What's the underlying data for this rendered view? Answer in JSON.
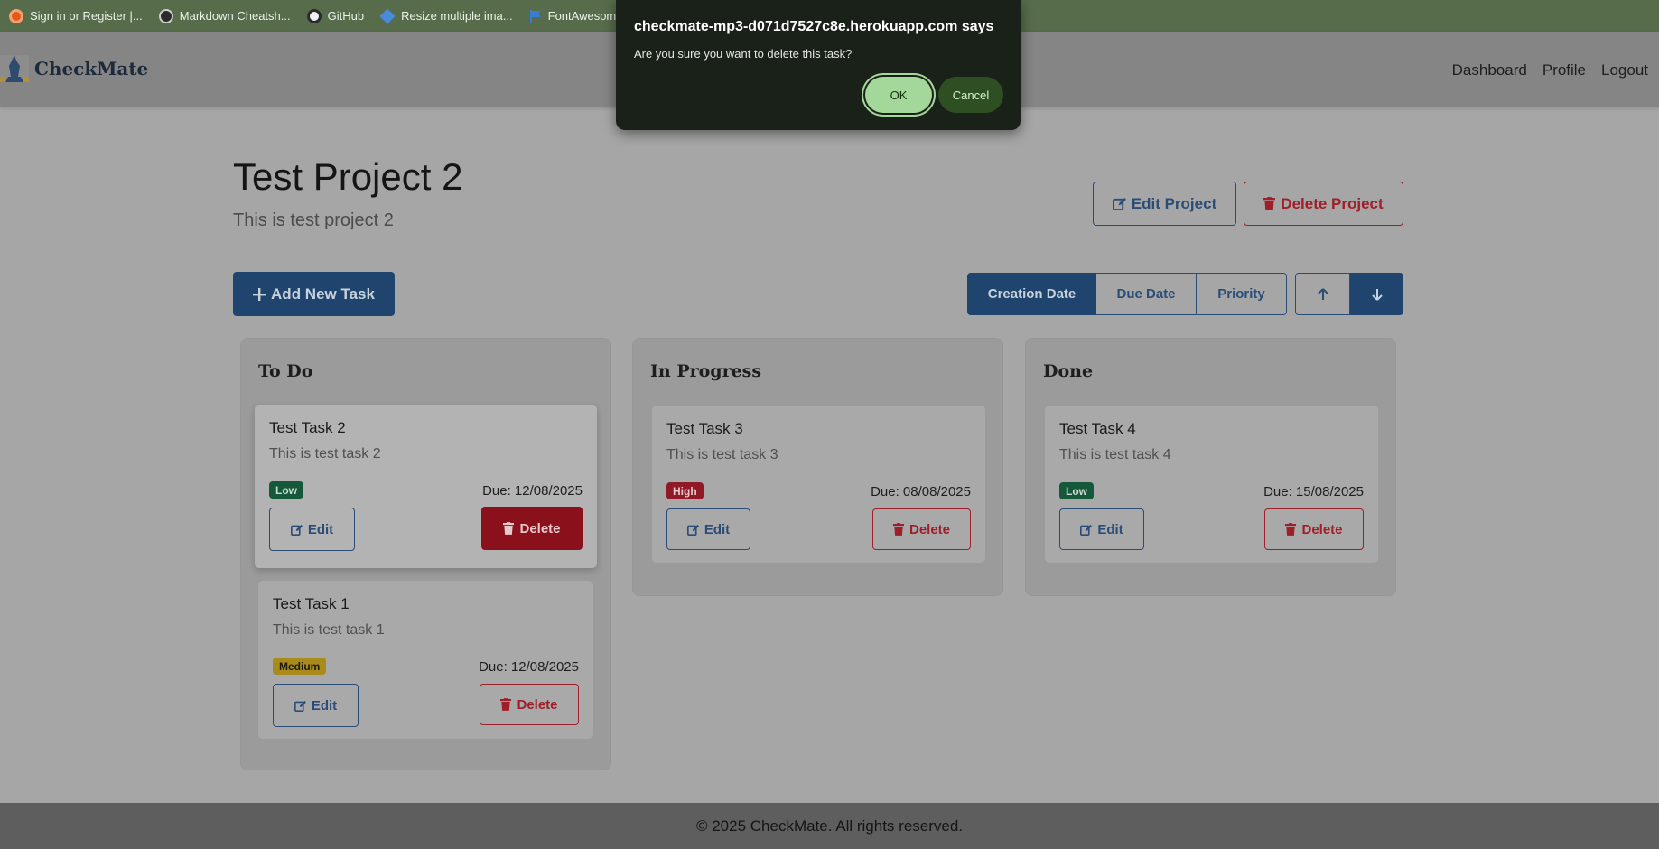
{
  "bookmarks": [
    {
      "label": "Sign in or Register |...",
      "icon": "circle-orange-icon",
      "color": "#e05a1a"
    },
    {
      "label": "Markdown Cheatsh...",
      "icon": "github-icon",
      "color": "#222222"
    },
    {
      "label": "GitHub",
      "icon": "github-icon",
      "color": "#222222"
    },
    {
      "label": "Resize multiple ima...",
      "icon": "diamond-blue-icon",
      "color": "#4a8ad8"
    },
    {
      "label": "FontAwesome",
      "icon": "flag-blue-icon",
      "color": "#3a7bd5"
    }
  ],
  "navbar": {
    "brand": "CheckMate",
    "links": [
      "Dashboard",
      "Profile",
      "Logout"
    ]
  },
  "project": {
    "title": "Test Project 2",
    "description": "This is test project 2",
    "edit_label": "Edit Project",
    "delete_label": "Delete Project"
  },
  "toolbar": {
    "add_task_label": "Add New Task",
    "sort_options": [
      "Creation Date",
      "Due Date",
      "Priority"
    ],
    "active_sort": "Creation Date"
  },
  "columns": [
    {
      "title": "To Do",
      "tasks": [
        {
          "title": "Test Task 2",
          "description": "This is test task 2",
          "priority": "Low",
          "due": "Due: 12/08/2025",
          "edit": "Edit",
          "delete": "Delete"
        },
        {
          "title": "Test Task 1",
          "description": "This is test task 1",
          "priority": "Medium",
          "due": "Due: 12/08/2025",
          "edit": "Edit",
          "delete": "Delete"
        }
      ]
    },
    {
      "title": "In Progress",
      "tasks": [
        {
          "title": "Test Task 3",
          "description": "This is test task 3",
          "priority": "High",
          "due": "Due: 08/08/2025",
          "edit": "Edit",
          "delete": "Delete"
        }
      ]
    },
    {
      "title": "Done",
      "tasks": [
        {
          "title": "Test Task 4",
          "description": "This is test task 4",
          "priority": "Low",
          "due": "Due: 15/08/2025",
          "edit": "Edit",
          "delete": "Delete"
        }
      ]
    }
  ],
  "footer": {
    "text": "© 2025 CheckMate. All rights reserved."
  },
  "dialog": {
    "title": "checkmate-mp3-d071d7527c8e.herokuapp.com says",
    "message": "Are you sure you want to delete this task?",
    "ok_label": "OK",
    "cancel_label": "Cancel"
  },
  "colors": {
    "primary": "#1f456e",
    "danger": "#8a111b",
    "low": "#16593a",
    "medium": "#a88b1a",
    "high": "#8f1a25",
    "dialog_ok": "#a4d79a",
    "dialog_cancel": "#2d4f22"
  }
}
